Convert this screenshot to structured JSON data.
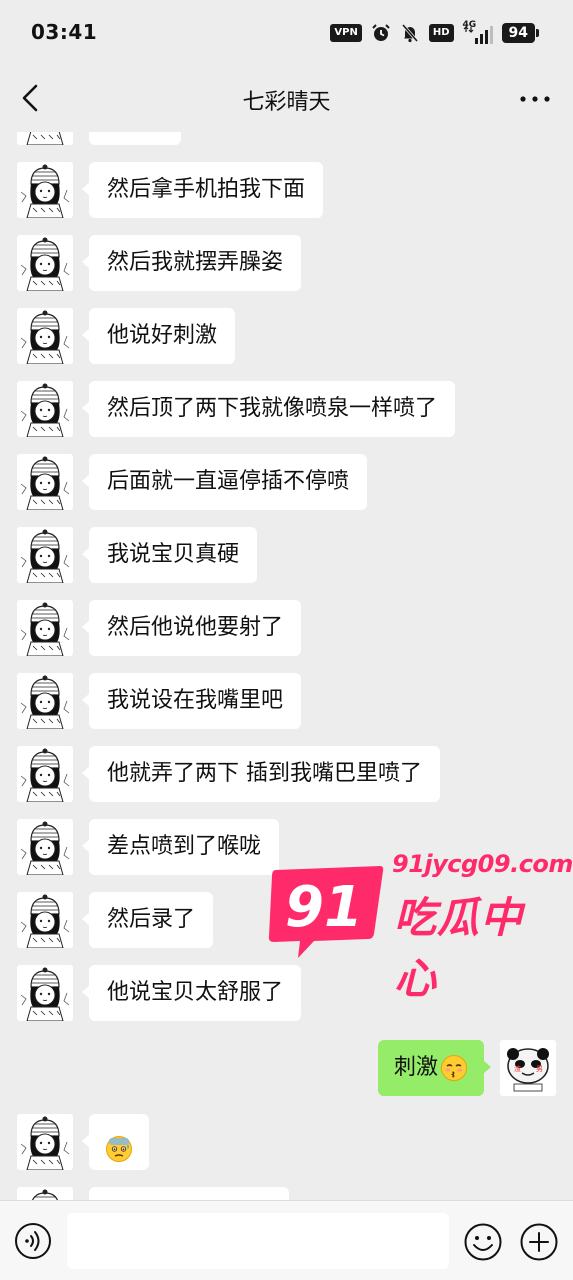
{
  "status_bar": {
    "time": "03:41",
    "vpn": "VPN",
    "hd": "HD",
    "network": "4G",
    "battery": "94",
    "icons": [
      "vpn-icon",
      "alarm-icon",
      "mute-bell-icon",
      "hd-icon",
      "signal-icon",
      "battery-icon"
    ]
  },
  "header": {
    "title": "七彩晴天",
    "back_icon": "chevron-left-icon",
    "more_icon": "more-dots-icon"
  },
  "messages": [
    {
      "side": "in",
      "text": "然后拿手机拍我下面"
    },
    {
      "side": "in",
      "text": "然后我就摆弄臊姿"
    },
    {
      "side": "in",
      "text": "他说好刺激"
    },
    {
      "side": "in",
      "text": "然后顶了两下我就像喷泉一样喷了"
    },
    {
      "side": "in",
      "text": "后面就一直逼停插不停喷"
    },
    {
      "side": "in",
      "text": "我说宝贝真硬"
    },
    {
      "side": "in",
      "text": "然后他说他要射了"
    },
    {
      "side": "in",
      "text": "我说设在我嘴里吧"
    },
    {
      "side": "in",
      "text": "他就弄了两下 插到我嘴巴里喷了"
    },
    {
      "side": "in",
      "text": "差点喷到了喉咙"
    },
    {
      "side": "in",
      "text": "然后录了"
    },
    {
      "side": "in",
      "text": "他说宝贝太舒服了"
    },
    {
      "side": "out",
      "text": "刺激",
      "emoji": "kissing-face-emoji"
    },
    {
      "side": "in",
      "text": "",
      "emoji": "sweat-face-emoji"
    }
  ],
  "watermark": {
    "badge": "91",
    "url": "91jycg09.com",
    "name": "吃瓜中心"
  },
  "input_bar": {
    "placeholder": "",
    "icons": [
      "voice-icon",
      "emoji-icon",
      "plus-icon"
    ]
  },
  "colors": {
    "background": "#ededed",
    "incoming_bubble": "#ffffff",
    "outgoing_bubble": "#95ec69",
    "watermark": "#ff2a6a"
  }
}
